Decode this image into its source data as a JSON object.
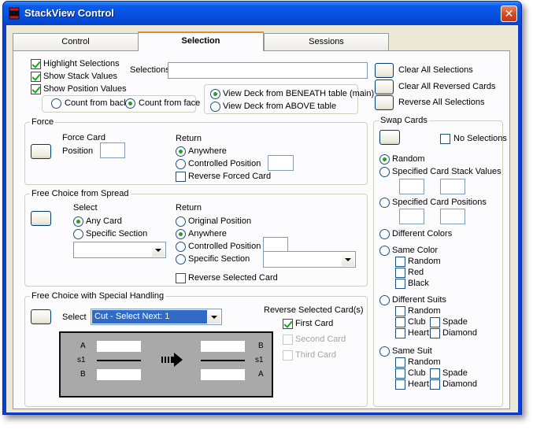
{
  "window": {
    "title": "StackView Control",
    "close_glyph": "✕"
  },
  "tabs": [
    {
      "label": "Control",
      "active": false
    },
    {
      "label": "Selection",
      "active": true
    },
    {
      "label": "Sessions",
      "active": false
    }
  ],
  "options": {
    "highlight_selections": {
      "label": "Highlight Selections",
      "checked": true
    },
    "show_stack_values": {
      "label": "Show Stack Values",
      "checked": true
    },
    "show_position_values": {
      "label": "Show Position Values",
      "checked": true
    },
    "count_from_back": "Count from back",
    "count_from_face": "Count from face",
    "selections_label": "Selections",
    "selections_value": "",
    "view_beneath": "View Deck from BENEATH table (main)",
    "view_above": "View Deck from ABOVE table"
  },
  "actions": {
    "clear_all_selections": "Clear All Selections",
    "clear_all_reversed": "Clear All Reversed Cards",
    "reverse_all_selections": "Reverse All Selections"
  },
  "force": {
    "title": "Force",
    "force_card": "Force Card",
    "position": "Position",
    "position_value": "",
    "return_label": "Return",
    "anywhere": "Anywhere",
    "controlled_position": "Controlled Position",
    "controlled_value": "",
    "reverse_forced": "Reverse Forced Card"
  },
  "spread": {
    "title": "Free Choice from Spread",
    "select_label": "Select",
    "any_card": "Any Card",
    "specific_section": "Specific Section",
    "section_value": "",
    "return_label": "Return",
    "original_position": "Original Position",
    "anywhere": "Anywhere",
    "controlled_position": "Controlled Position",
    "controlled_value": "",
    "specific_section_return": "Specific Section",
    "return_section_value": "",
    "reverse_selected": "Reverse Selected Card"
  },
  "special": {
    "title": "Free Choice with Special Handling",
    "select_label": "Select",
    "select_value": "Cut - Select Next: 1",
    "reverse_title": "Reverse Selected Card(s)",
    "first_card": "First Card",
    "second_card": "Second Card",
    "third_card": "Third Card",
    "preview": {
      "left_top": "A",
      "left_mid": "s1",
      "left_bottom": "B",
      "right_top": "B",
      "right_mid": "s1",
      "right_bottom": "A"
    }
  },
  "swap": {
    "title": "Swap Cards",
    "no_selections": "No Selections",
    "random": "Random",
    "specified_stack_values": "Specified Card Stack Values",
    "specified_positions": "Specified Card Positions",
    "different_colors": "Different Colors",
    "same_color": "Same Color",
    "same_color_random": "Random",
    "red": "Red",
    "black": "Black",
    "different_suits": "Different Suits",
    "ds_random": "Random",
    "ds_club": "Club",
    "ds_spade": "Spade",
    "ds_heart": "Heart",
    "ds_diamond": "Diamond",
    "same_suit": "Same Suit",
    "ss_random": "Random",
    "ss_club": "Club",
    "ss_spade": "Spade",
    "ss_heart": "Heart",
    "ss_diamond": "Diamond"
  }
}
